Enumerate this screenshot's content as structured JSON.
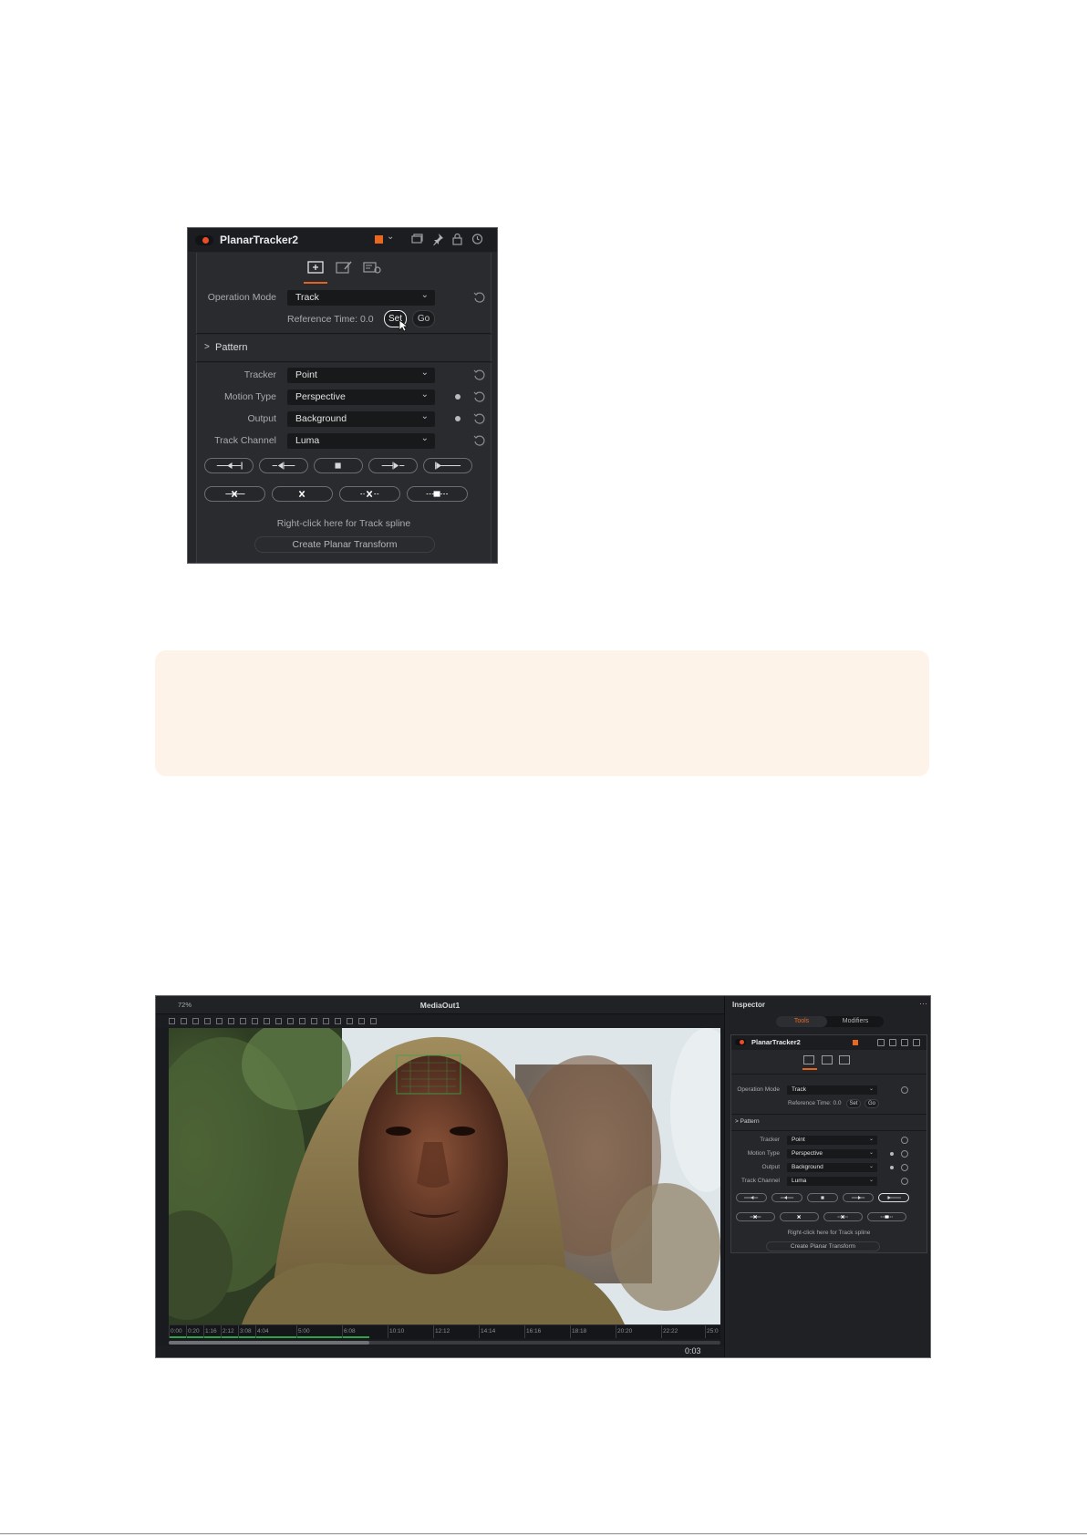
{
  "top_panel": {
    "node_title": "PlanarTracker2",
    "fields": {
      "operation_mode": {
        "label": "Operation Mode",
        "value": "Track"
      },
      "reference_time": {
        "label": "Reference Time:",
        "value": "0.0",
        "set": "Set",
        "go": "Go"
      },
      "tracker": {
        "label": "Tracker",
        "value": "Point"
      },
      "motion_type": {
        "label": "Motion Type",
        "value": "Perspective"
      },
      "output": {
        "label": "Output",
        "value": "Background"
      },
      "track_channel": {
        "label": "Track Channel",
        "value": "Luma"
      }
    },
    "pattern": "Pattern",
    "hint": "Right-click here for Track spline",
    "create": "Create Planar Transform",
    "icons": [
      "node-enable-icon",
      "color-swatch-icon",
      "copy-icon",
      "pin-icon",
      "lock-icon",
      "reset-icon",
      "tools-tab-icon",
      "modifier-tab-icon",
      "settings-tab-icon",
      "track-backward-icon",
      "step-backward-icon",
      "stop-icon",
      "step-forward-icon",
      "track-forward-icon",
      "delete-to-start-icon",
      "delete-icon",
      "delete-to-end-icon",
      "clear-track-icon"
    ],
    "accent_color": "#e8691e"
  },
  "screenshot": {
    "viewer_title": "MediaOut1",
    "zoom": "72%",
    "timecode": "0:03",
    "ruler_ticks": [
      "0:00",
      "0:20",
      "1:16",
      "2:12",
      "3:08",
      "4:04",
      "5:00",
      "6:08",
      "10:10",
      "12:12",
      "14:14",
      "16:16",
      "18:18",
      "20:20",
      "22:22",
      "25:0"
    ],
    "inspector": {
      "title": "Inspector",
      "tabs": [
        "Tools",
        "Modifiers"
      ],
      "node_title": "PlanarTracker2",
      "operation_mode": {
        "label": "Operation Mode",
        "value": "Track"
      },
      "reference_time": {
        "label": "Reference Time:",
        "value": "0.0",
        "set": "Set",
        "go": "Go"
      },
      "pattern": "Pattern",
      "tracker": {
        "label": "Tracker",
        "value": "Point"
      },
      "motion_type": {
        "label": "Motion Type",
        "value": "Perspective"
      },
      "output": {
        "label": "Output",
        "value": "Background"
      },
      "track_channel": {
        "label": "Track Channel",
        "value": "Luma"
      },
      "hint": "Right-click here for Track spline",
      "create": "Create Planar Transform"
    }
  }
}
